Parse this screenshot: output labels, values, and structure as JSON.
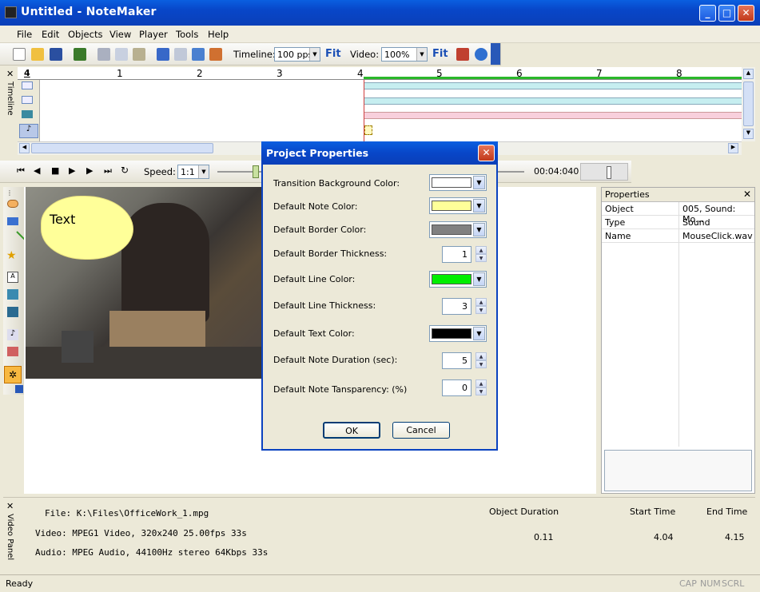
{
  "window": {
    "title": "Untitled - NoteMaker"
  },
  "menu": [
    "File",
    "Edit",
    "Objects",
    "View",
    "Player",
    "Tools",
    "Help"
  ],
  "toolbar": {
    "timeline_label": "Timeline:",
    "timeline_value": "100 pps",
    "fit1": "Fit",
    "video_label": "Video:",
    "video_value": "100%",
    "fit2": "Fit"
  },
  "timeline": {
    "side_label": "Timeline",
    "corner": "4",
    "ruler_ticks": [
      "1",
      "2",
      "3",
      "4",
      "5",
      "6",
      "7",
      "8"
    ],
    "track_colors": [
      "#c6eef0",
      "#c6eef0",
      "#f8d0dc"
    ]
  },
  "player": {
    "speed_label": "Speed:",
    "speed_value": "1:1",
    "time": "00:04:040"
  },
  "note": {
    "text": "Text"
  },
  "properties": {
    "title": "Properties",
    "rows": [
      {
        "key": "Object",
        "value": "005, Sound: Mo..."
      },
      {
        "key": "Type",
        "value": "Sound"
      },
      {
        "key": "Name",
        "value": "MouseClick.wav"
      }
    ]
  },
  "video_panel": {
    "side_label": "Video Panel",
    "file": "File: K:\\Files\\OfficeWork_1.mpg",
    "video": "Video: MPEG1 Video, 320x240 25.00fps 33s",
    "audio": "Audio: MPEG Audio, 44100Hz stereo 64Kbps 33s",
    "headers": [
      "Object Duration",
      "Start Time",
      "End Time"
    ],
    "values": [
      "0.11",
      "4.04",
      "4.15"
    ]
  },
  "status": {
    "text": "Ready",
    "indicators": [
      "CAP",
      "NUM",
      "SCRL"
    ]
  },
  "dialog": {
    "title": "Project Properties",
    "fields": {
      "transition_bg": {
        "label": "Transition Background Color:",
        "color": "#ffffff"
      },
      "note_color": {
        "label": "Default Note Color:",
        "color": "#ffff99"
      },
      "border_color": {
        "label": "Default Border Color:",
        "color": "#808080"
      },
      "border_thickness": {
        "label": "Default Border Thickness:",
        "value": "1"
      },
      "line_color": {
        "label": "Default Line Color:",
        "color": "#00ee00"
      },
      "line_thickness": {
        "label": "Default Line Thickness:",
        "value": "3"
      },
      "text_color": {
        "label": "Default Text Color:",
        "color": "#000000"
      },
      "note_duration": {
        "label": "Default Note Duration (sec):",
        "value": "5"
      },
      "note_transparency": {
        "label": "Default Note Tansparency: (%)",
        "value": "0"
      }
    },
    "ok": "OK",
    "cancel": "Cancel"
  }
}
